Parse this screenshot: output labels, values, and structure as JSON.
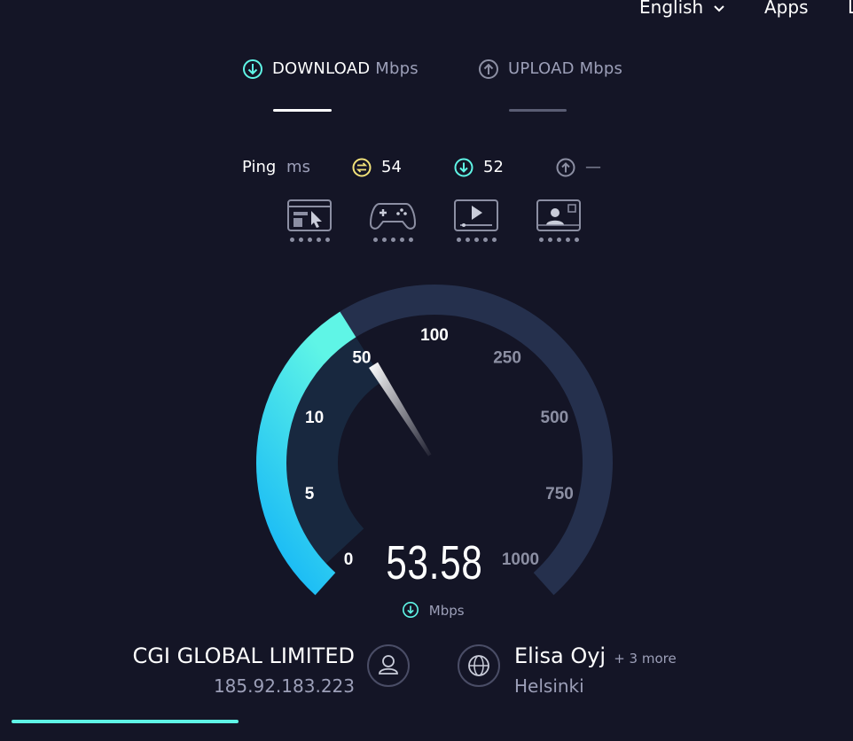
{
  "nav": {
    "language": "English",
    "apps": "Apps",
    "more": "L"
  },
  "tabs": [
    {
      "label": "DOWNLOAD",
      "unit": "Mbps",
      "active": true
    },
    {
      "label": "UPLOAD",
      "unit": "Mbps",
      "active": false
    }
  ],
  "ping": {
    "label": "Ping",
    "unit": "ms",
    "idle": "54",
    "download": "52",
    "upload": "—"
  },
  "activity_icons": [
    "browsing-icon",
    "gaming-icon",
    "streaming-icon",
    "video-call-icon"
  ],
  "gauge": {
    "labels": [
      "0",
      "5",
      "10",
      "50",
      "100",
      "250",
      "500",
      "750",
      "1000"
    ],
    "value": 53.58,
    "value_text": "53.58",
    "unit": "Mbps"
  },
  "provider": {
    "isp_name": "CGI GLOBAL LIMITED",
    "ip": "185.92.183.223",
    "server_name": "Elisa Oyj",
    "server_more": "+ 3 more",
    "server_city": "Helsinki"
  },
  "colors": {
    "background": "#141526",
    "accent_cyan": "#5ff5e6",
    "accent_blue": "#12b4f7",
    "gauge_track": "#25304d",
    "ping_idle": "#f2e27a",
    "muted": "#9c9fb8"
  },
  "progress": 0.27
}
